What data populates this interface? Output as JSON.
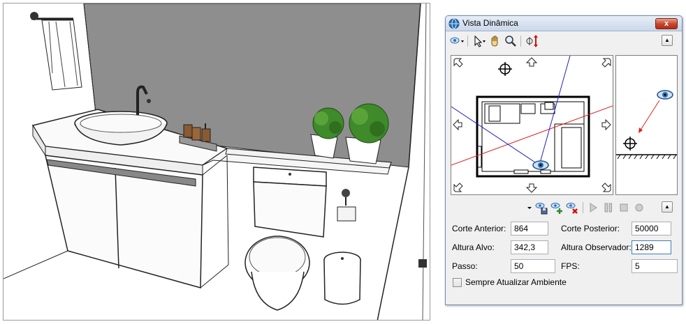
{
  "panel": {
    "title": "Vista Dinâmica",
    "close_label": "x",
    "collapse_label": "▲"
  },
  "form": {
    "corte_anterior": {
      "label": "Corte Anterior:",
      "value": "864"
    },
    "corte_posterior": {
      "label": "Corte Posterior:",
      "value": "50000"
    },
    "altura_alvo": {
      "label": "Altura Alvo:",
      "value": "342,3"
    },
    "altura_observador": {
      "label": "Altura Observador:",
      "value": "1289"
    },
    "passo": {
      "label": "Passo:",
      "value": "50"
    },
    "fps": {
      "label": "FPS:",
      "value": "5"
    },
    "sempre_atualizar": {
      "label": "Sempre Atualizar Ambiente",
      "checked": false
    }
  },
  "colors": {
    "panel_bg": "#f0f0f0",
    "eye_blue": "#2a6fb5",
    "view_line_red": "#e02020",
    "view_line_blue": "#2020c0"
  },
  "icons": [
    "eye-camera-icon",
    "pointer-icon",
    "pan-hand-icon",
    "zoom-icon",
    "height-adjust-icon",
    "save-camera-icon",
    "add-camera-icon",
    "delete-camera-icon",
    "play-icon",
    "pause-icon",
    "stop-icon",
    "record-icon"
  ]
}
